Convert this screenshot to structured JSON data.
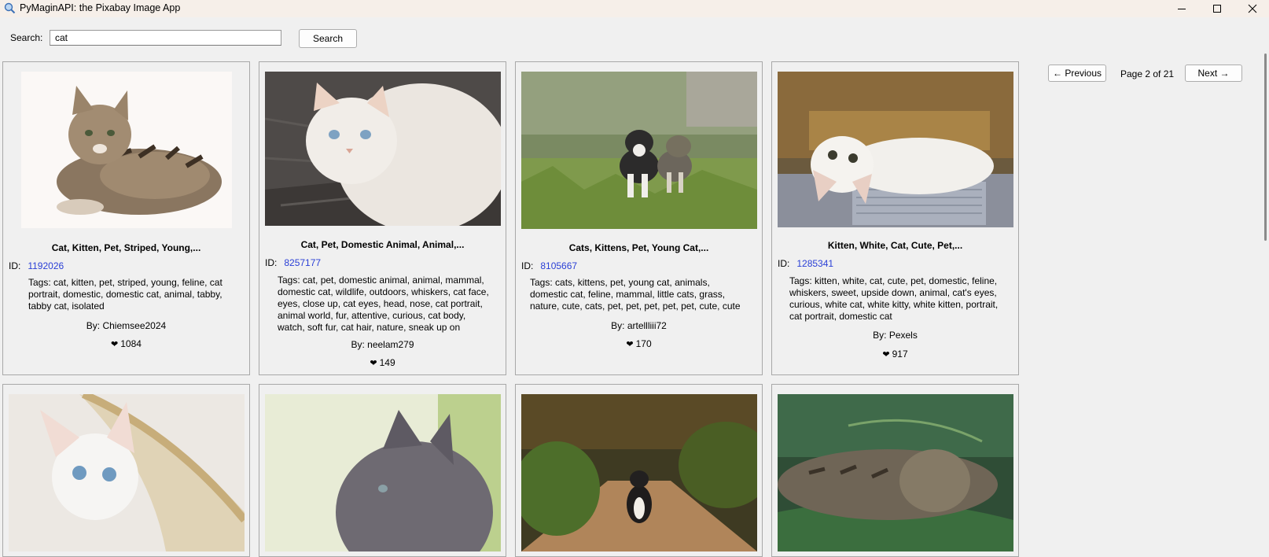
{
  "window": {
    "title": "PyMaginAPI: the Pixabay Image App",
    "minimize_icon": "minimize-icon",
    "maximize_icon": "maximize-icon",
    "close_icon": "close-icon"
  },
  "search": {
    "label": "Search:",
    "value": "cat",
    "button_label": "Search"
  },
  "pagination": {
    "prev_label": "← Previous",
    "page_text": "Page 2 of 21",
    "next_label": "Next →"
  },
  "labels": {
    "id": "ID:",
    "like_icon": "❤"
  },
  "cards": [
    {
      "title": "Cat, Kitten, Pet, Striped, Young,...",
      "id": "1192026",
      "tags": "Tags: cat, kitten, pet, striped, young, feline, cat portrait, domestic, domestic cat, animal, tabby, tabby cat, isolated",
      "author": "By: Chiemsee2024",
      "likes": "1084"
    },
    {
      "title": "Cat, Pet, Domestic Animal, Animal,...",
      "id": "8257177",
      "tags": "Tags: cat, pet, domestic animal, animal, mammal, domestic cat, wildlife, outdoors, whiskers, cat face, eyes, close up, cat eyes, head, nose, cat portrait, animal world, fur, attentive, curious, cat body, watch, soft fur, cat hair, nature, sneak up on",
      "author": "By: neelam279",
      "likes": "149"
    },
    {
      "title": "Cats, Kittens, Pet, Young Cat,...",
      "id": "8105667",
      "tags": "Tags: cats, kittens, pet, young cat, animals, domestic cat, feline, mammal, little cats, grass, nature, cute, cats, pet, pet, pet, pet, pet, cute, cute",
      "author": "By: artellliii72",
      "likes": "170"
    },
    {
      "title": "Kitten, White, Cat, Cute, Pet,...",
      "id": "1285341",
      "tags": "Tags: kitten, white, cat, cute, pet, domestic, feline, whiskers, sweet, upside down, animal, cat's eyes, curious, white cat, white kitty, white kitten, portrait, cat portrait, domestic cat",
      "author": "By: Pexels",
      "likes": "917"
    }
  ]
}
